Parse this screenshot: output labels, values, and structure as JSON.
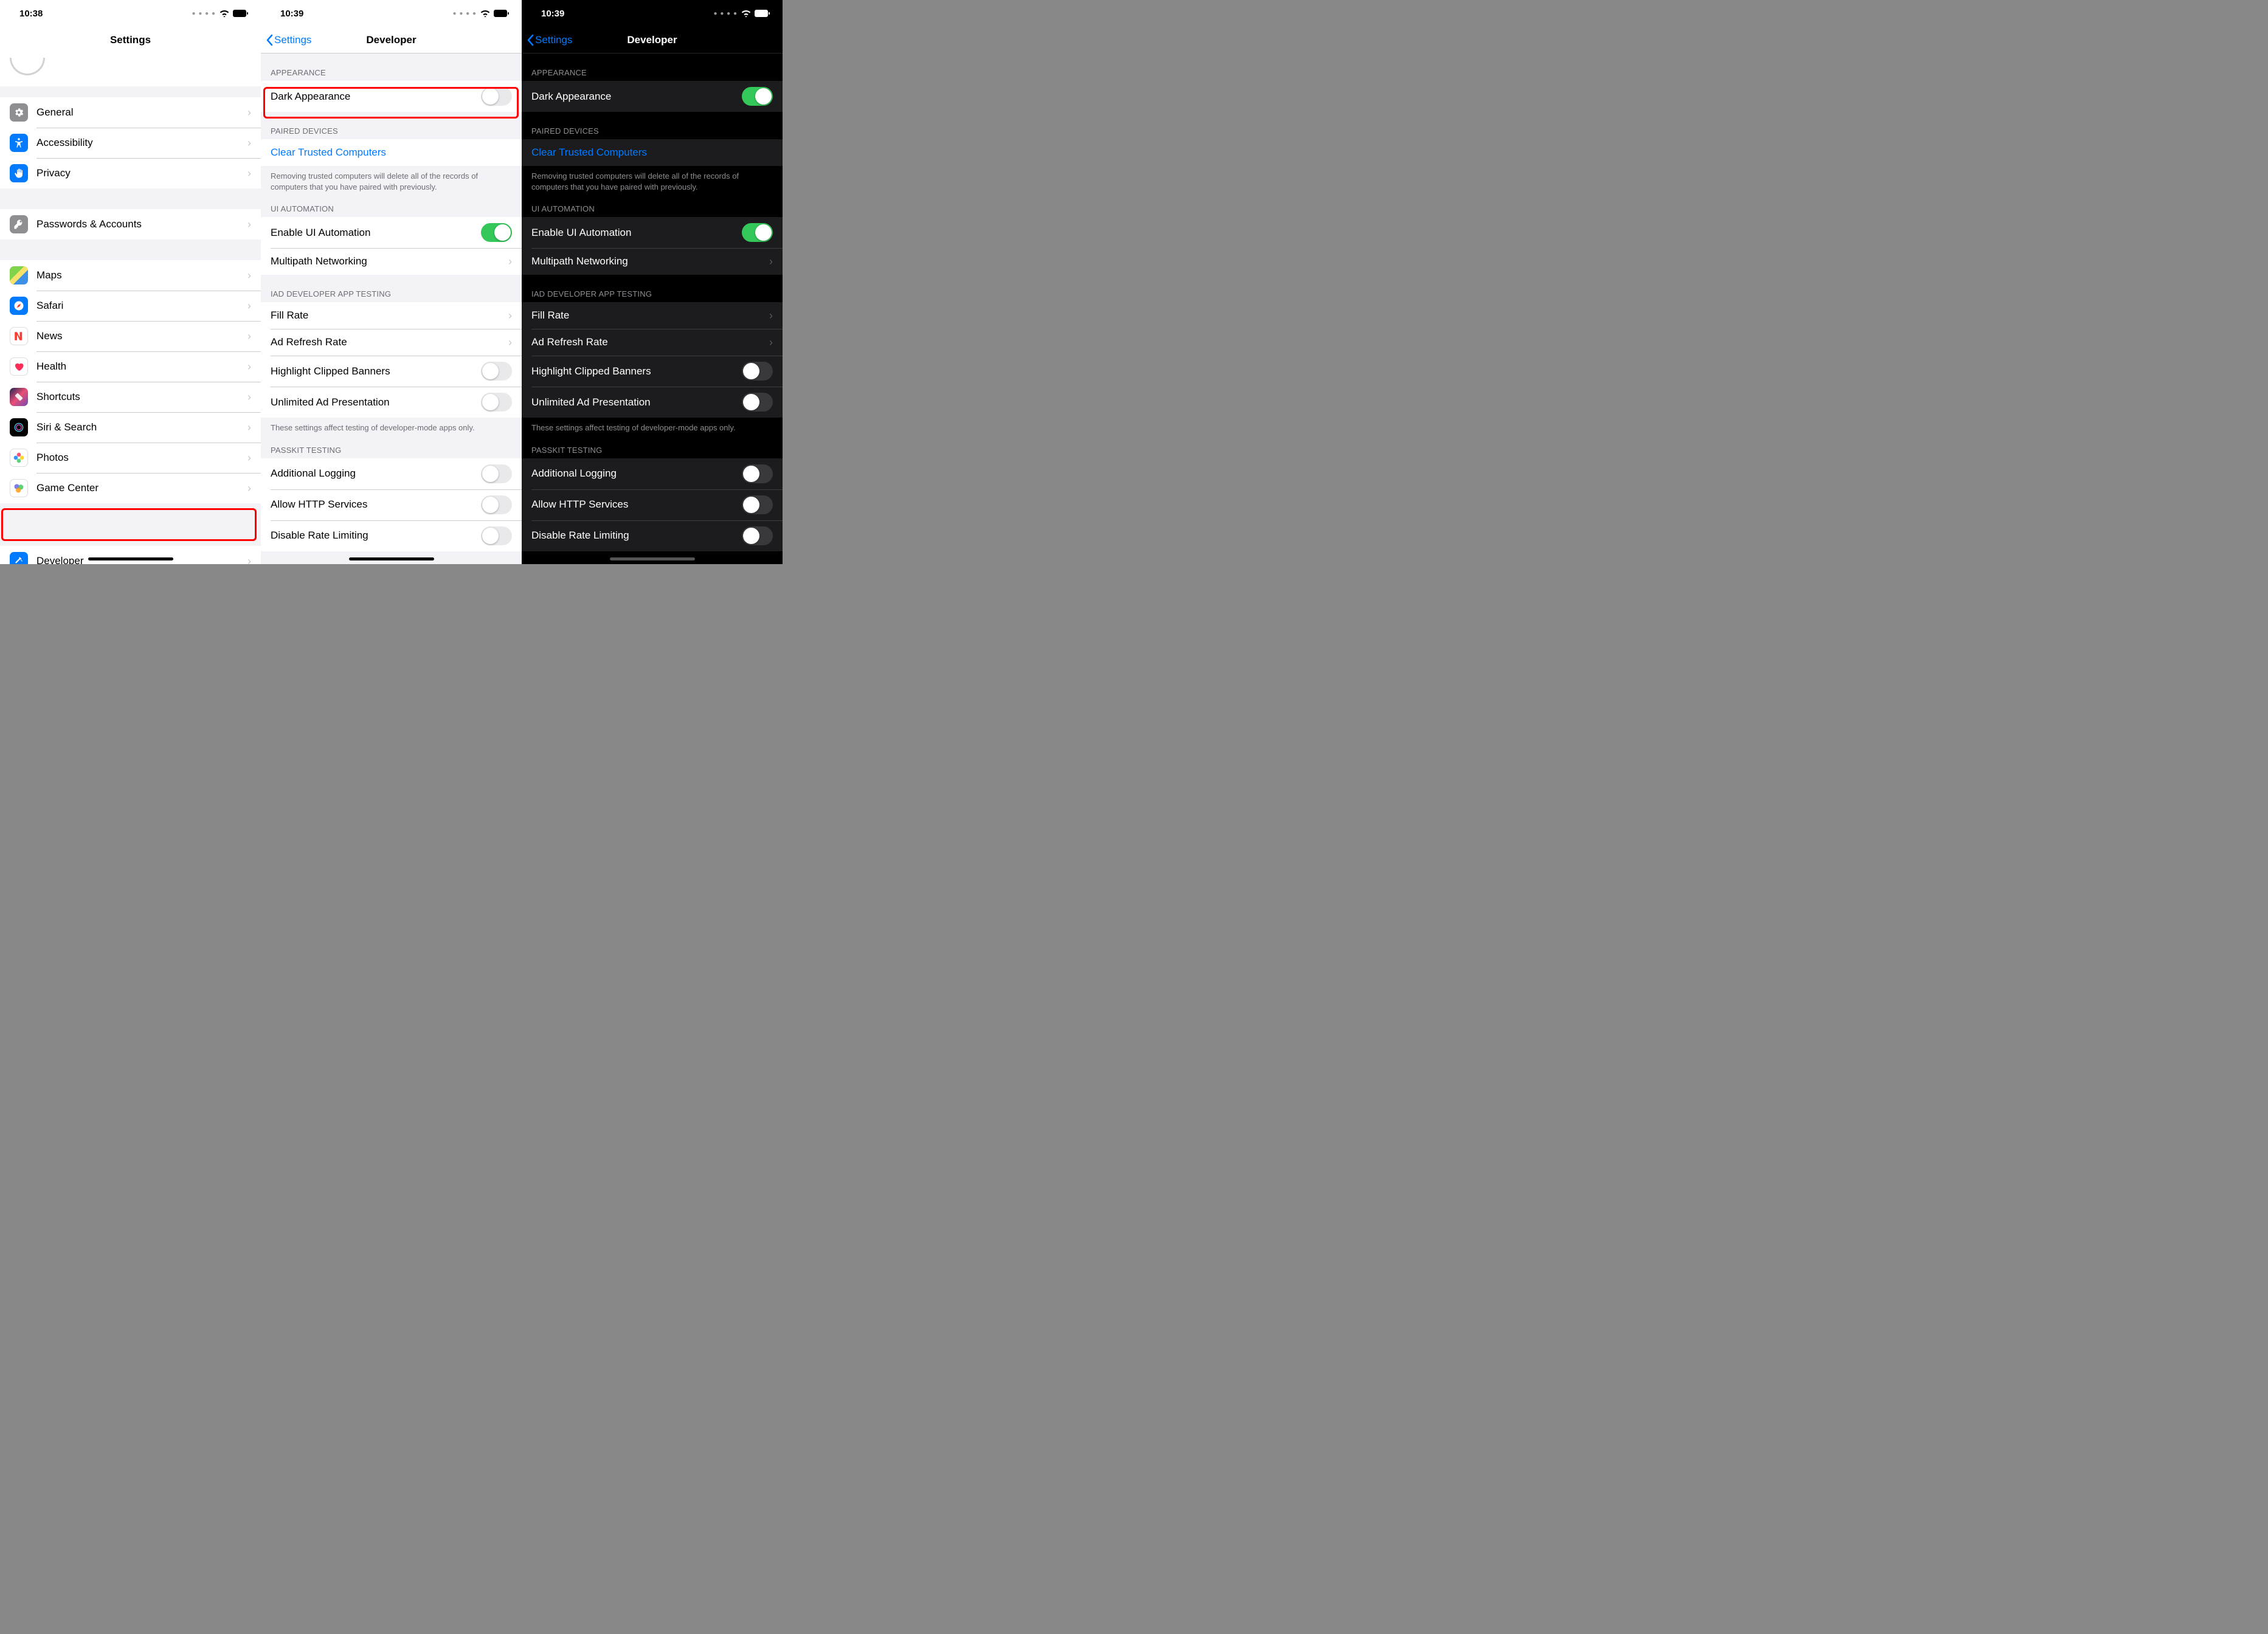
{
  "screen1": {
    "time": "10:38",
    "title": "Settings",
    "groups": [
      {
        "items": [
          {
            "icon": "gear-icon",
            "bg": "#8e8e93",
            "label": "General"
          },
          {
            "icon": "accessibility-icon",
            "bg": "#007aff",
            "label": "Accessibility"
          },
          {
            "icon": "hand-icon",
            "bg": "#007aff",
            "label": "Privacy"
          }
        ]
      },
      {
        "items": [
          {
            "icon": "key-icon",
            "bg": "#8e8e93",
            "label": "Passwords & Accounts"
          }
        ]
      },
      {
        "items": [
          {
            "icon": "maps-icon",
            "bg": "maps",
            "label": "Maps"
          },
          {
            "icon": "compass-icon",
            "bg": "#007aff",
            "label": "Safari"
          },
          {
            "icon": "news-icon",
            "bg": "#ffffff",
            "label": "News"
          },
          {
            "icon": "heart-icon",
            "bg": "#ffffff",
            "label": "Health"
          },
          {
            "icon": "shortcuts-icon",
            "bg": "shortcuts",
            "label": "Shortcuts"
          },
          {
            "icon": "siri-icon",
            "bg": "#000000",
            "label": "Siri & Search"
          },
          {
            "icon": "photos-icon",
            "bg": "photos",
            "label": "Photos"
          },
          {
            "icon": "gamecenter-icon",
            "bg": "gamecenter",
            "label": "Game Center"
          }
        ]
      },
      {
        "items": [
          {
            "icon": "hammer-icon",
            "bg": "#007aff",
            "label": "Developer"
          }
        ]
      }
    ]
  },
  "screen2": {
    "time": "10:39",
    "back": "Settings",
    "title": "Developer",
    "appearance_header": "APPEARANCE",
    "dark_appearance": "Dark Appearance",
    "dark_on": false,
    "paired_header": "PAIRED DEVICES",
    "clear_trusted": "Clear Trusted Computers",
    "paired_footer": "Removing trusted computers will delete all of the records of computers that you have paired with previously.",
    "ui_header": "UI AUTOMATION",
    "enable_ui": "Enable UI Automation",
    "enable_ui_on": true,
    "multipath": "Multipath Networking",
    "iad_header": "IAD DEVELOPER APP TESTING",
    "fill_rate": "Fill Rate",
    "ad_refresh": "Ad Refresh Rate",
    "highlight_clipped": "Highlight Clipped Banners",
    "unlimited_ad": "Unlimited Ad Presentation",
    "iad_footer": "These settings affect testing of developer-mode apps only.",
    "passkit_header": "PASSKIT TESTING",
    "additional_logging": "Additional Logging",
    "allow_http": "Allow HTTP Services",
    "disable_rate": "Disable Rate Limiting"
  },
  "screen3": {
    "time": "10:39",
    "back": "Settings",
    "title": "Developer",
    "dark_on": true
  }
}
